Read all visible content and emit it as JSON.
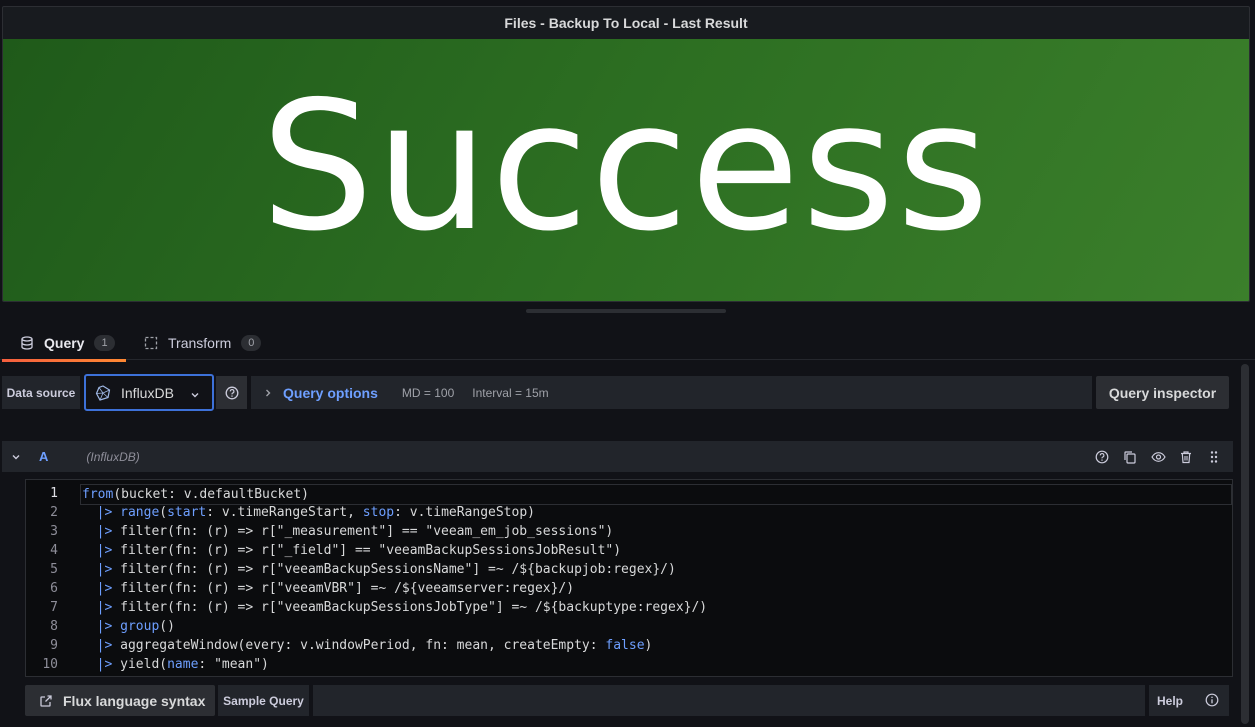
{
  "panel": {
    "title": "Files - Backup To Local - Last Result",
    "value": "Success",
    "background_color": "#2f6d25"
  },
  "tabs": [
    {
      "label": "Query",
      "count": "1",
      "active": true
    },
    {
      "label": "Transform",
      "count": "0",
      "active": false
    }
  ],
  "datasource": {
    "label": "Data source",
    "selected": "InfluxDB"
  },
  "query_options": {
    "title": "Query options",
    "md": "MD = 100",
    "interval": "Interval = 15m"
  },
  "query_inspector": "Query inspector",
  "query": {
    "name": "A",
    "datasource": "(InfluxDB)"
  },
  "code_lines": [
    {
      "n": "1",
      "text": "from(bucket: v.defaultBucket)"
    },
    {
      "n": "2",
      "text": "  |> range(start: v.timeRangeStart, stop: v.timeRangeStop)"
    },
    {
      "n": "3",
      "text": "  |> filter(fn: (r) => r[\"_measurement\"] == \"veeam_em_job_sessions\")"
    },
    {
      "n": "4",
      "text": "  |> filter(fn: (r) => r[\"_field\"] == \"veeamBackupSessionsJobResult\")"
    },
    {
      "n": "5",
      "text": "  |> filter(fn: (r) => r[\"veeamBackupSessionsName\"] =~ /${backupjob:regex}/)"
    },
    {
      "n": "6",
      "text": "  |> filter(fn: (r) => r[\"veeamVBR\"] =~ /${veeamserver:regex}/)"
    },
    {
      "n": "7",
      "text": "  |> filter(fn: (r) => r[\"veeamBackupSessionsJobType\"] =~ /${backuptype:regex}/)"
    },
    {
      "n": "8",
      "text": "  |> group()"
    },
    {
      "n": "9",
      "text": "  |> aggregateWindow(every: v.windowPeriod, fn: mean, createEmpty: false)"
    },
    {
      "n": "10",
      "text": "  |> yield(name: \"mean\")"
    }
  ],
  "footer": {
    "flux_syntax": "Flux language syntax",
    "sample_query": "Sample Query",
    "help": "Help"
  },
  "colors": {
    "accent_blue": "#6e9fff",
    "tab_underline": "#f55f3e",
    "success_green": "#2f6d25"
  }
}
